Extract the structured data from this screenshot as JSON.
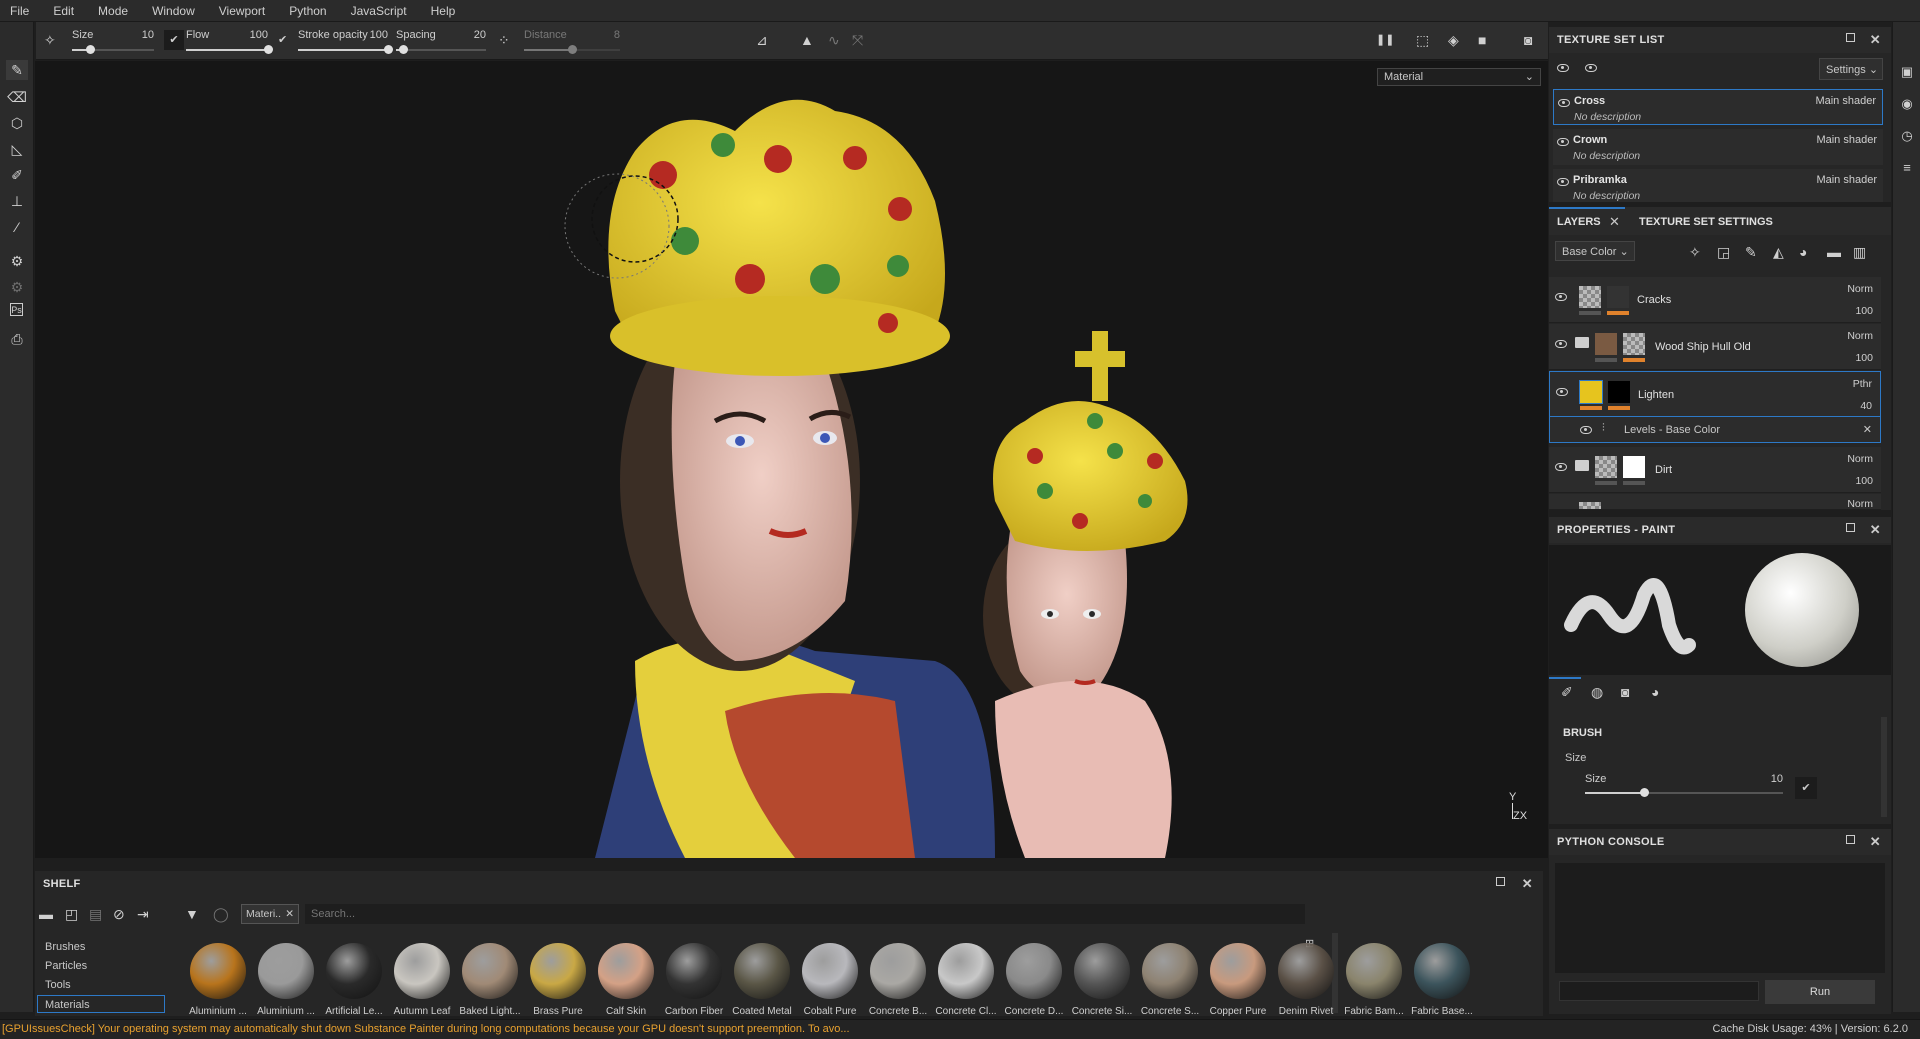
{
  "menu": [
    "File",
    "Edit",
    "Mode",
    "Window",
    "Viewport",
    "Python",
    "JavaScript",
    "Help"
  ],
  "toolbar": {
    "size_label": "Size",
    "size_value": "10",
    "size_level": 0.22,
    "flow_label": "Flow",
    "flow_value": "100",
    "flow_level": 1.0,
    "stroke_opacity_label": "Stroke opacity",
    "stroke_opacity_value": "100",
    "stroke_opacity_level": 1.0,
    "spacing_label": "Spacing",
    "spacing_value": "20",
    "spacing_level": 0.08,
    "distance_label": "Distance",
    "distance_value": "8",
    "distance_level": 0.5
  },
  "viewport": {
    "mode_select": "Material",
    "axis_y": "Y",
    "axis_zx": "ZX"
  },
  "texture_set_list": {
    "title": "TEXTURE SET LIST",
    "settings_label": "Settings",
    "items": [
      {
        "name": "Cross",
        "shader": "Main shader",
        "description": "No description",
        "selected": true
      },
      {
        "name": "Crown",
        "shader": "Main shader",
        "description": "No description",
        "selected": false
      },
      {
        "name": "Pribramka",
        "shader": "Main shader",
        "description": "No description",
        "selected": false
      }
    ]
  },
  "layers": {
    "tab_layers": "LAYERS",
    "tab_settings": "TEXTURE SET SETTINGS",
    "channel": "Base Color",
    "items": [
      {
        "name": "Cracks",
        "blend": "Norm",
        "opacity": "100"
      },
      {
        "name": "Wood Ship Hull Old",
        "blend": "Norm",
        "opacity": "100"
      },
      {
        "name": "Lighten",
        "blend": "Pthr",
        "opacity": "40"
      },
      {
        "name": "Dirt",
        "blend": "Norm",
        "opacity": "100"
      },
      {
        "name": "",
        "blend": "Norm",
        "opacity": ""
      }
    ],
    "effect": "Levels - Base Color"
  },
  "properties": {
    "title": "PROPERTIES - PAINT",
    "section": "BRUSH",
    "size_label": "Size",
    "size_row_label": "Size",
    "size_value": "10",
    "size_level": 0.3
  },
  "python_console": {
    "title": "PYTHON CONSOLE",
    "run_label": "Run"
  },
  "shelf": {
    "title": "SHELF",
    "filter_chip": "Materi..",
    "search_placeholder": "Search...",
    "categories": [
      "Brushes",
      "Particles",
      "Tools",
      "Materials"
    ],
    "materials": [
      {
        "name": "Aluminium ...",
        "color": "#b8741c"
      },
      {
        "name": "Aluminium ...",
        "color": "#9a9a9a"
      },
      {
        "name": "Artificial Le...",
        "color": "#2a2a2a"
      },
      {
        "name": "Autumn Leaf",
        "color": "#c9c6c0"
      },
      {
        "name": "Baked Light...",
        "color": "#a08a76"
      },
      {
        "name": "Brass Pure",
        "color": "#c9a845"
      },
      {
        "name": "Calf Skin",
        "color": "#d4a186"
      },
      {
        "name": "Carbon Fiber",
        "color": "#333333"
      },
      {
        "name": "Coated Metal",
        "color": "#5a5646"
      },
      {
        "name": "Cobalt Pure",
        "color": "#b8b8bc"
      },
      {
        "name": "Concrete B...",
        "color": "#aaa8a4"
      },
      {
        "name": "Concrete Cl...",
        "color": "#c8c8c8"
      },
      {
        "name": "Concrete D...",
        "color": "#8a8a8a"
      },
      {
        "name": "Concrete Si...",
        "color": "#555555"
      },
      {
        "name": "Concrete S...",
        "color": "#8e8272"
      },
      {
        "name": "Copper Pure",
        "color": "#c89a7e"
      },
      {
        "name": "Denim Rivet",
        "color": "#5a5046"
      },
      {
        "name": "Fabric Bam...",
        "color": "#8a846c"
      },
      {
        "name": "Fabric Base...",
        "color": "#3c545c"
      }
    ]
  },
  "status": {
    "message": "[GPUIssuesCheck] Your operating system may automatically shut down Substance Painter during long computations because your GPU doesn't support preemption. To avo...",
    "cache": "Cache Disk Usage: 43% | Version: 6.2.0"
  },
  "colors": {
    "accent": "#2d79c7",
    "orange": "#e0822c",
    "warning": "#e8a12f"
  }
}
